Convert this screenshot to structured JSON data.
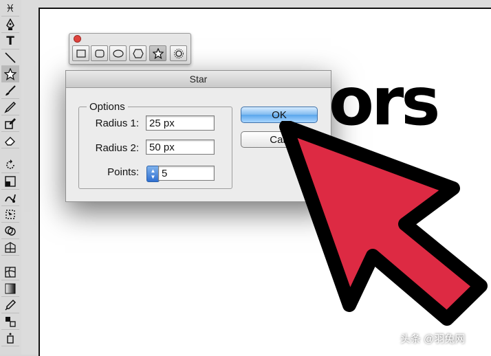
{
  "dialog": {
    "title": "Star",
    "options_group_title": "Options",
    "radius1_label": "Radius 1:",
    "radius1_value": "25 px",
    "radius2_label": "Radius 2:",
    "radius2_value": "50 px",
    "points_label": "Points:",
    "points_value": "5",
    "ok_label": "OK",
    "cancel_label": "Can"
  },
  "canvas": {
    "artboard_text": "ors"
  },
  "watermark": {
    "text": "头条 @羽兔网"
  },
  "colors": {
    "arrow_fill": "#dd2a43",
    "arrow_stroke": "#000000",
    "ok_button": "#5aa6ec",
    "stepper": "#2f6fd1",
    "palette_close": "#e0443e"
  },
  "toolbar": {
    "tools": [
      "lasso-icon",
      "pen-icon",
      "type-icon",
      "line-icon",
      "star-icon",
      "paintbrush-icon",
      "pencil-icon",
      "blob-brush-icon",
      "eraser-icon",
      "rotate-icon",
      "scale-icon",
      "warp-icon",
      "free-transform-icon",
      "shape-builder-icon",
      "perspective-grid-icon",
      "mesh-icon",
      "gradient-icon",
      "eyedropper-icon",
      "blend-icon",
      "symbol-sprayer-icon"
    ],
    "selected": "star-icon"
  },
  "shape_palette": {
    "tools": [
      "rectangle-icon",
      "rounded-rectangle-icon",
      "ellipse-icon",
      "polygon-icon",
      "star-icon",
      "flare-icon"
    ],
    "selected": "star-icon"
  }
}
